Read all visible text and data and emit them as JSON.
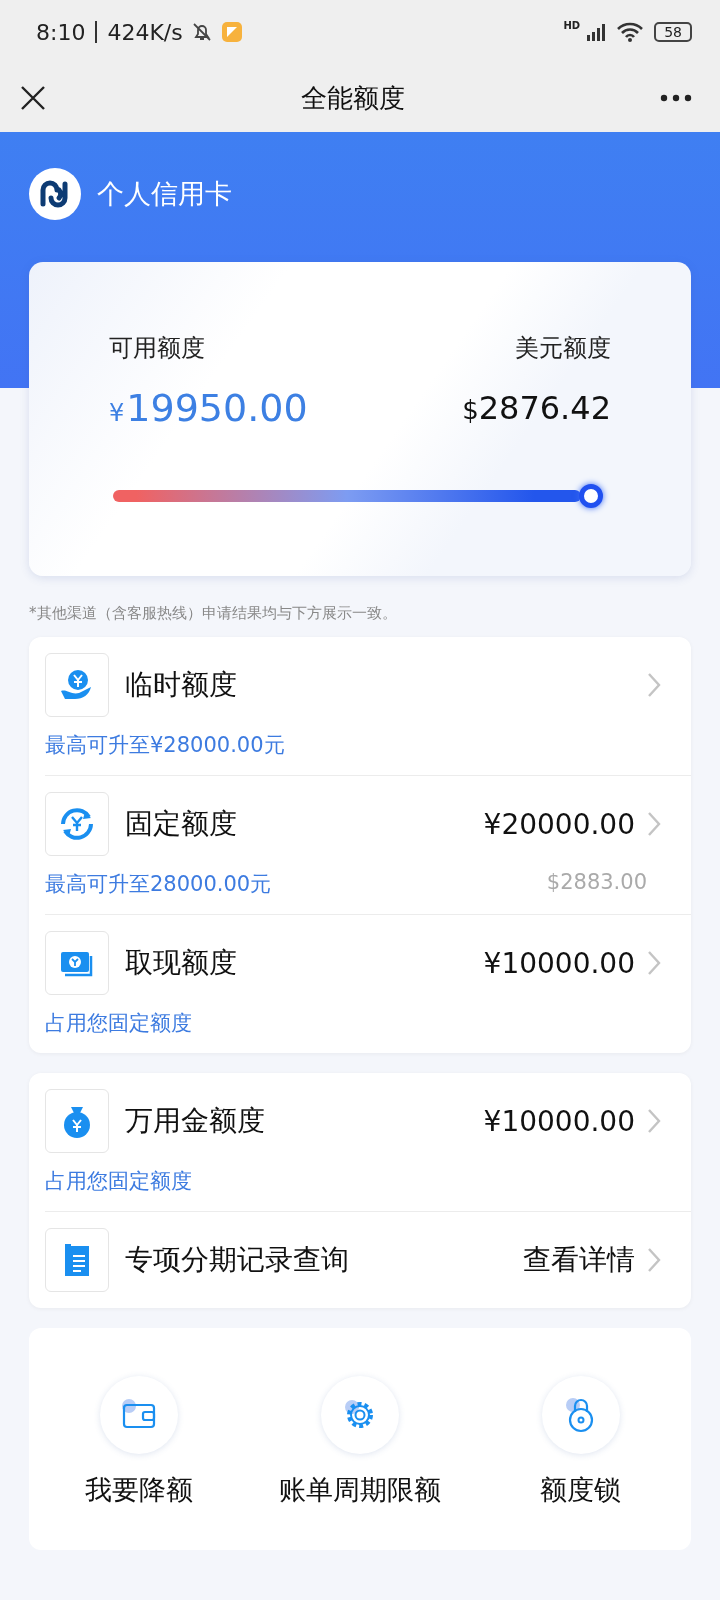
{
  "status_bar": {
    "time": "8:10",
    "speed": "424K/s",
    "network": "HD",
    "battery": "58"
  },
  "nav": {
    "title": "全能额度"
  },
  "header": {
    "product": "个人信用卡"
  },
  "limit_card": {
    "available_label": "可用额度",
    "available_currency": "¥",
    "available_amount": "19950.00",
    "usd_label": "美元额度",
    "usd_currency": "$",
    "usd_amount": "2876.42"
  },
  "note": "*其他渠道（含客服热线）申请结果均与下方展示一致。",
  "groups": [
    {
      "rows": [
        {
          "title": "临时额度",
          "sub": "最高可升至¥28000.00元"
        },
        {
          "title": "固定额度",
          "value": "¥20000.00",
          "sub": "最高可升至28000.00元",
          "sub_value": "$2883.00"
        },
        {
          "title": "取现额度",
          "value": "¥10000.00",
          "sub": "占用您固定额度"
        }
      ]
    },
    {
      "rows": [
        {
          "title": "万用金额度",
          "value": "¥10000.00",
          "sub": "占用您固定额度"
        },
        {
          "title": "专项分期记录查询",
          "value": "查看详情"
        }
      ]
    }
  ],
  "actions": [
    {
      "label": "我要降额"
    },
    {
      "label": "账单周期限额"
    },
    {
      "label": "额度锁"
    }
  ]
}
